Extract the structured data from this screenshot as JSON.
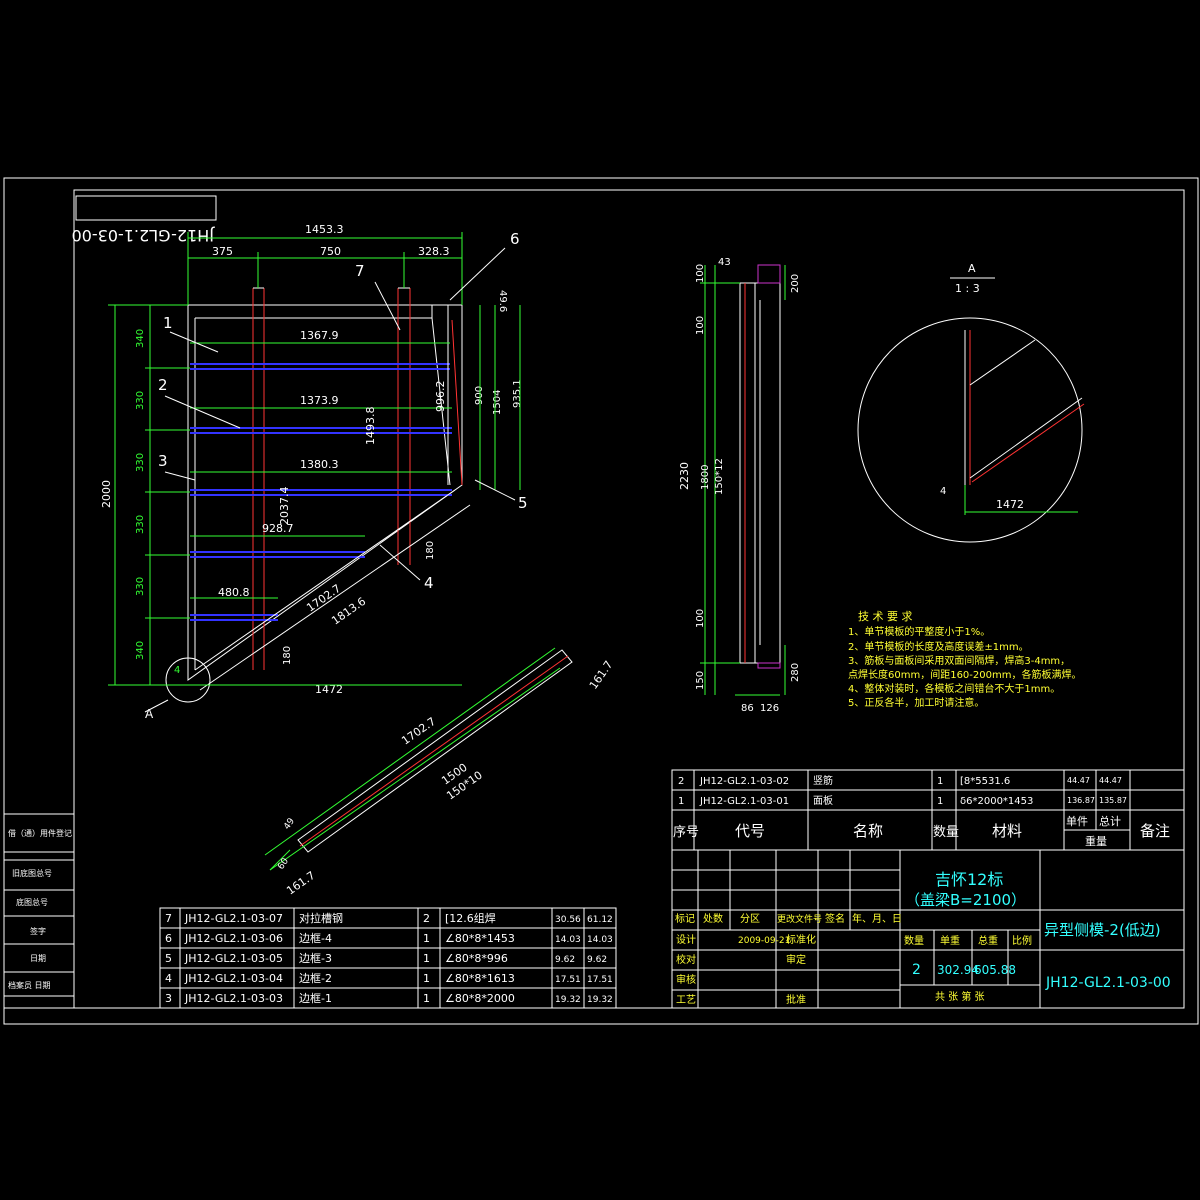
{
  "sheet": {
    "stamp_label": "JH12-GL2.1-03-00",
    "view_a_label": "A",
    "view_a_scale": "1 : 3",
    "arrow_a_label": "A"
  },
  "front_view": {
    "dims_top": [
      "1453.3",
      "375",
      "750",
      "328.3"
    ],
    "dims_left": [
      "2000",
      "340",
      "330",
      "330",
      "330",
      "330",
      "340"
    ],
    "dims_inner": [
      "1367.9",
      "1373.9",
      "1380.3",
      "928.7",
      "480.8",
      "2037.4",
      "1493.8",
      "996.2",
      "900",
      "1504",
      "935.1",
      "49.6",
      "180",
      "180",
      "1702.7",
      "1813.6",
      "1472"
    ],
    "balloons": [
      "1",
      "2",
      "3",
      "4",
      "5",
      "6",
      "7"
    ],
    "detail_callout": "4"
  },
  "side_view": {
    "dims": [
      "100",
      "43",
      "200",
      "100",
      "2230",
      "1800",
      "150*12",
      "100",
      "150",
      "280",
      "86",
      "126"
    ]
  },
  "section_view": {
    "dims": [
      "1702.7",
      "1500",
      "150*10",
      "161.7",
      "161.7",
      "49",
      "60"
    ]
  },
  "detail_view": {
    "dims": [
      "4",
      "1472"
    ]
  },
  "tech_notes": {
    "title": "技 术 要 求",
    "lines": [
      "1、单节模板的平整度小于1%。",
      "2、单节模板的长度及高度误差±1mm。",
      "3、筋板与面板间采用双面间隔焊，焊高3-4mm，",
      "   点焊长度60mm，间距160-200mm，各筋板满焊。",
      "4、整体对装时，各模板之间错台不大于1mm。",
      "5、正反各半，加工时请注意。"
    ]
  },
  "bom_upper": {
    "rows": [
      [
        "2",
        "JH12-GL2.1-03-02",
        "竖筋",
        "1",
        "[8*5531.6",
        "44.47",
        "44.47",
        ""
      ],
      [
        "1",
        "JH12-GL2.1-03-01",
        "面板",
        "1",
        "δ6*2000*1453",
        "136.87",
        "135.87",
        ""
      ]
    ],
    "header": [
      "序号",
      "代号",
      "名称",
      "数量",
      "材料",
      "单件",
      "总计",
      "备注"
    ],
    "header_sub": "重量"
  },
  "bom_lower": {
    "rows": [
      [
        "7",
        "JH12-GL2.1-03-07",
        "对拉槽钢",
        "2",
        "[12.6组焊",
        "30.56",
        "61.12"
      ],
      [
        "6",
        "JH12-GL2.1-03-06",
        "边框-4",
        "1",
        "∠80*8*1453",
        "14.03",
        "14.03"
      ],
      [
        "5",
        "JH12-GL2.1-03-05",
        "边框-3",
        "1",
        "∠80*8*996",
        "9.62",
        "9.62"
      ],
      [
        "4",
        "JH12-GL2.1-03-04",
        "边框-2",
        "1",
        "∠80*8*1613",
        "17.51",
        "17.51"
      ],
      [
        "3",
        "JH12-GL2.1-03-03",
        "边框-1",
        "1",
        "∠80*8*2000",
        "19.32",
        "19.32"
      ]
    ]
  },
  "title_block": {
    "project_line1": "吉怀12标",
    "project_line2": "（盖梁B=2100）",
    "drawing_name": "异型侧模-2(低边)",
    "drawing_code": "JH12-GL2.1-03-00",
    "rev_header": [
      "标记",
      "处数",
      "分区",
      "更改文件号",
      "签名",
      "年、月、日"
    ],
    "roles": [
      "设计",
      "校对",
      "审核",
      "工艺"
    ],
    "roles_right": [
      "标准化",
      "审定",
      "批准"
    ],
    "date": "2009-09-21",
    "qty_header": [
      "数量",
      "单重",
      "总重",
      "比例"
    ],
    "qty_values": [
      "2",
      "302.94",
      "605.88",
      ""
    ],
    "sheet_info": "共 张 第 张"
  },
  "left_margin": {
    "labels": [
      "借（通）用件登记",
      "旧底图总号",
      "底图总号",
      "签字",
      "日期",
      "档案员 日期"
    ]
  },
  "colors": {
    "background": "#000000",
    "lines": "#ffffff",
    "dims": "#33ff33",
    "notes": "#ffff33",
    "title": "#33ffff",
    "red": "#ff3333",
    "blue": "#3333ff"
  }
}
